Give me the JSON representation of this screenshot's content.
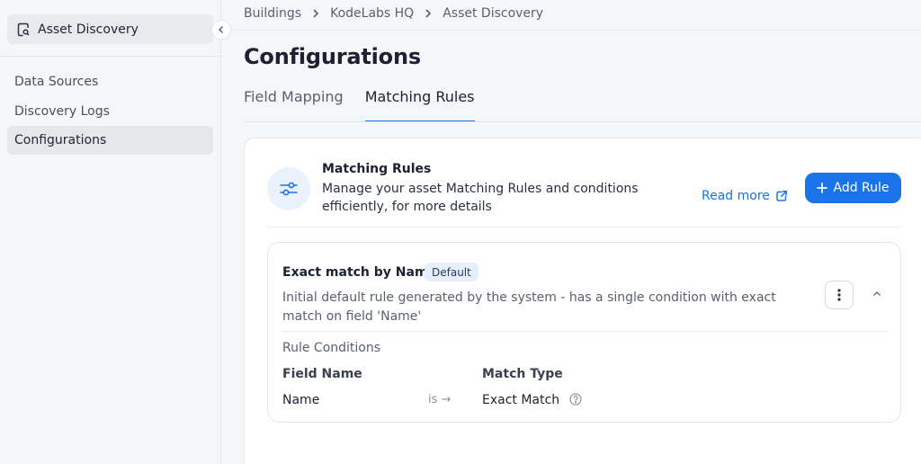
{
  "sidebar": {
    "app_name": "Asset Discovery",
    "app_icon": "document-search-icon",
    "collapse_icon": "chevron-left-icon",
    "items": [
      {
        "label": "Data Sources",
        "active": false
      },
      {
        "label": "Discovery Logs",
        "active": false
      },
      {
        "label": "Configurations",
        "active": true
      }
    ]
  },
  "breadcrumb": {
    "items": [
      "Buildings",
      "KodeLabs HQ",
      "Asset Discovery"
    ]
  },
  "page": {
    "title": "Configurations",
    "tabs": [
      {
        "label": "Field Mapping",
        "active": false
      },
      {
        "label": "Matching Rules",
        "active": true
      }
    ]
  },
  "matching_rules": {
    "icon": "sliders-icon",
    "title": "Matching Rules",
    "description": "Manage your asset Matching Rules and conditions efficiently, for more details",
    "read_more_label": "Read more",
    "add_rule_label": "Add Rule"
  },
  "rule": {
    "name": "Exact match by Name",
    "badge": "Default",
    "description": "Initial default rule generated by the system - has a single condition with exact match on field 'Name'",
    "conditions_label": "Rule Conditions",
    "columns": {
      "field_name": "Field Name",
      "match_type": "Match Type"
    },
    "condition": {
      "field_name": "Name",
      "operator": "is →",
      "match_type": "Exact Match"
    }
  },
  "colors": {
    "accent": "#1a73e8",
    "sidebar_bg": "#f5f6f8",
    "badge_bg": "#e6effd"
  }
}
